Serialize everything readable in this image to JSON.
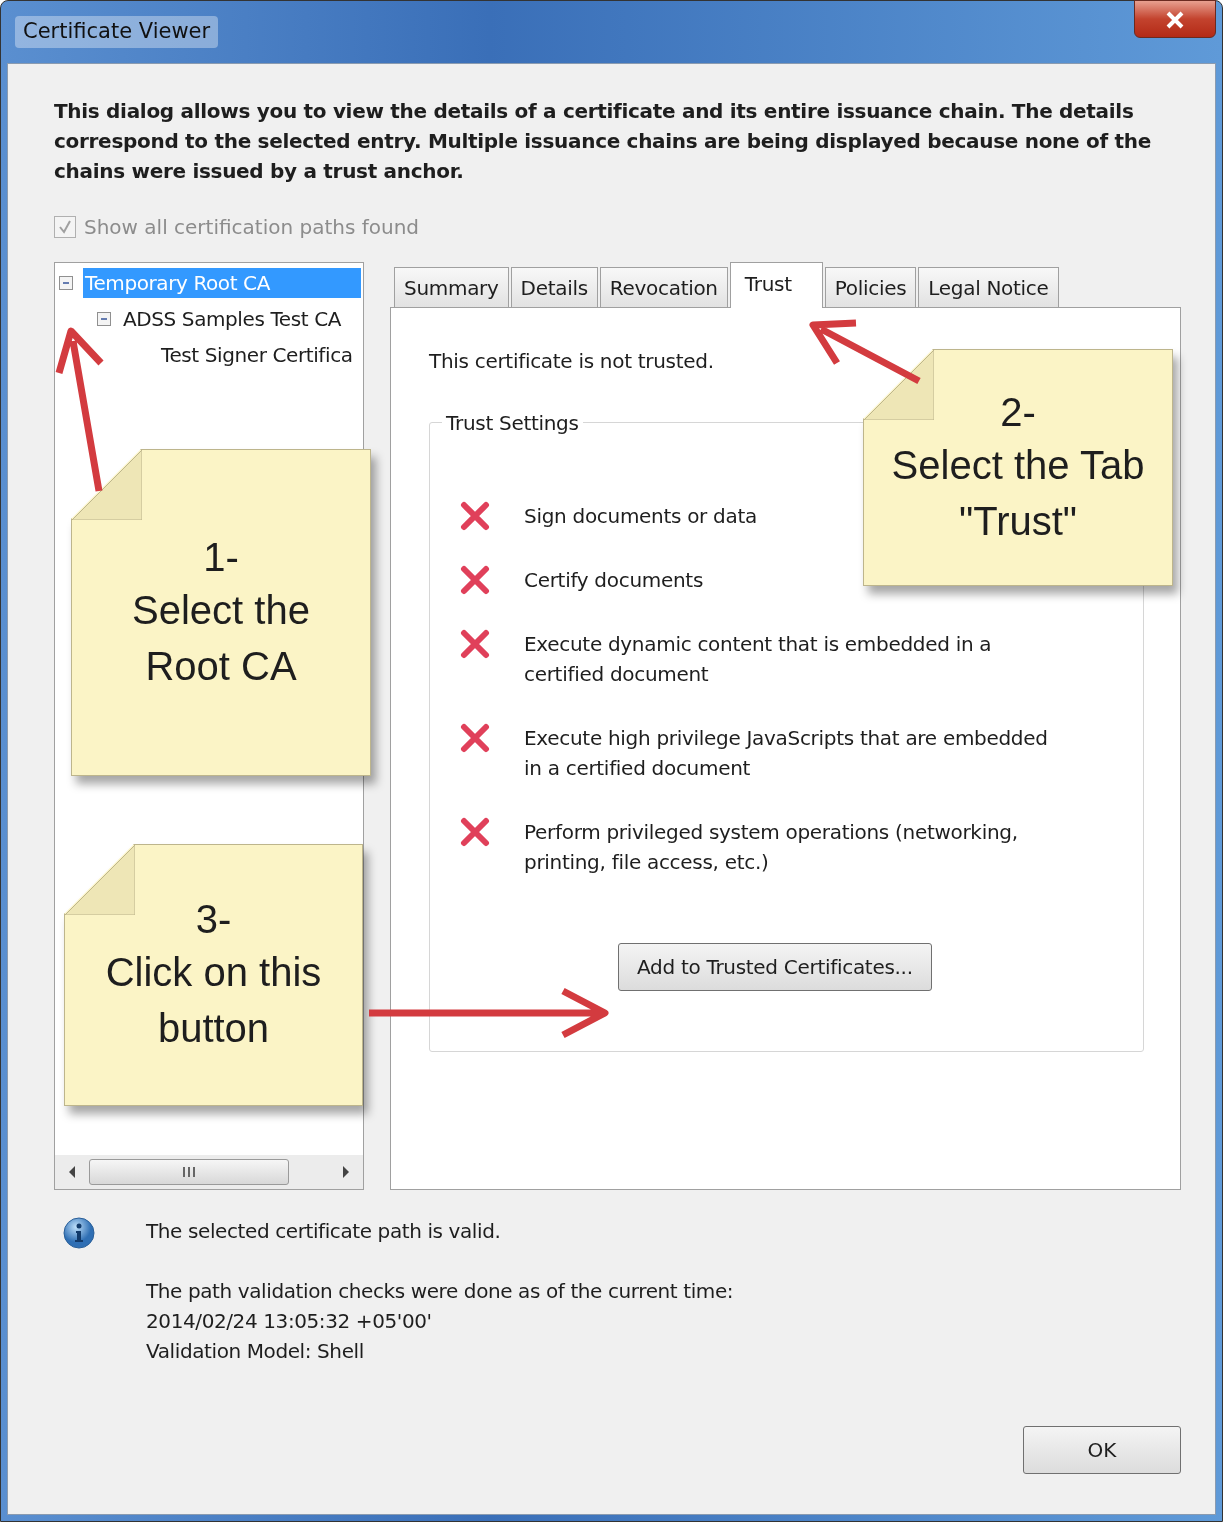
{
  "window": {
    "title": "Certificate Viewer"
  },
  "intro": "This dialog allows you to view the details of a certificate and its entire issuance chain. The details correspond to the selected entry. Multiple issuance chains are being displayed because none of the chains were issued by a trust anchor.",
  "show_all_paths": {
    "label": "Show all certification paths found",
    "checked": true,
    "disabled": true
  },
  "tree": [
    {
      "label": "Temporary Root CA",
      "selected": true,
      "expanded": true,
      "children": [
        {
          "label": "ADSS Samples Test CA",
          "selected": false,
          "expanded": true,
          "children": [
            {
              "label": "Test Signer Certifica",
              "selected": false
            }
          ]
        }
      ]
    }
  ],
  "tabs": [
    {
      "label": "Summary",
      "selected": false
    },
    {
      "label": "Details",
      "selected": false
    },
    {
      "label": "Revocation",
      "selected": false
    },
    {
      "label": "Trust",
      "selected": true
    },
    {
      "label": "Policies",
      "selected": false
    },
    {
      "label": "Legal Notice",
      "selected": false
    }
  ],
  "trust": {
    "status": "This certificate is not trusted.",
    "group_title": "Trust Settings",
    "settings": [
      {
        "label": "Sign documents or data",
        "allowed": false
      },
      {
        "label": "Certify documents",
        "allowed": false
      },
      {
        "label": "Execute dynamic content that is embedded in a certified document",
        "allowed": false
      },
      {
        "label": "Execute high privilege JavaScripts that are embedded in a certified document",
        "allowed": false
      },
      {
        "label": "Perform privileged system operations (networking, printing, file access, etc.)",
        "allowed": false
      }
    ],
    "button": "Add to Trusted Certificates..."
  },
  "validation": {
    "status": "The selected certificate path is valid.",
    "details": [
      "The path validation checks were done as of the current time:",
      "2014/02/24 13:05:32 +05'00'",
      "Validation Model: Shell"
    ]
  },
  "buttons": [
    "OK"
  ],
  "callouts": [
    {
      "number": "1-",
      "lines": [
        "Select the",
        "Root CA"
      ]
    },
    {
      "number": "2-",
      "lines": [
        "Select the Tab",
        "\"Trust\""
      ]
    },
    {
      "number": "3-",
      "lines": [
        "Click on this",
        "button"
      ]
    }
  ]
}
